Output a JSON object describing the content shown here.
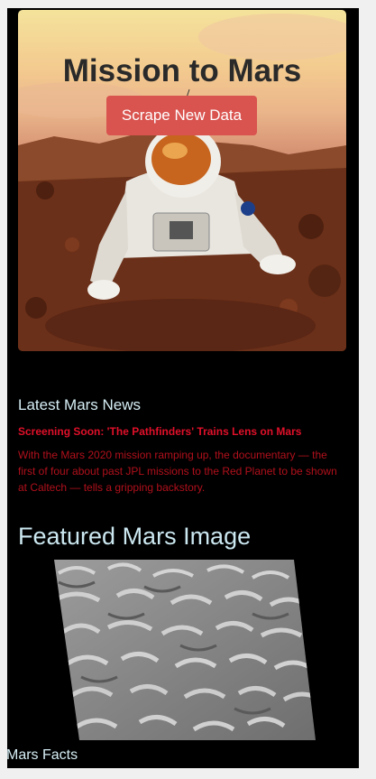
{
  "hero": {
    "title": "Mission to Mars",
    "scrape_button_label": "Scrape New Data"
  },
  "news": {
    "heading": "Latest Mars News",
    "title": "Screening Soon: 'The Pathfinders' Trains Lens on Mars",
    "paragraph": "With the Mars 2020 mission ramping up, the documentary — the first of four about past JPL missions to the Red Planet to be shown at Caltech — tells a gripping backstory."
  },
  "featured": {
    "heading": "Featured Mars Image"
  },
  "facts": {
    "heading": "Mars Facts"
  },
  "colors": {
    "page_background": "#000000",
    "button": "#d9534f",
    "news_title": "#e0102a",
    "news_body": "#b0101c",
    "heading_text": "#d6eef5"
  }
}
